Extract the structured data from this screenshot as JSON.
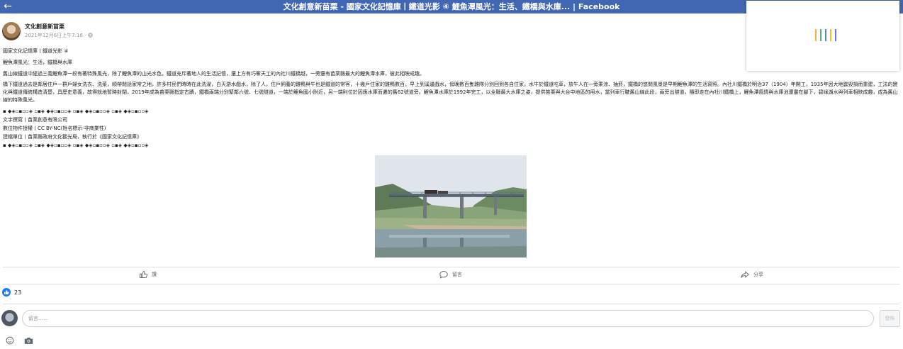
{
  "window": {
    "title": "文化創意新苗栗 - 國家文化記憶庫丨鐵道光影 ④ 鯉魚潭風光：生活、鐵橋與水庫... | Facebook"
  },
  "colors": {
    "header": "#4267b2",
    "like": "#1877f2",
    "loader": [
      "#f5b041",
      "#58b05a",
      "#4a90d9",
      "#f0c419",
      "#6b7ad8"
    ]
  },
  "post": {
    "author": "文化創意新苗栗",
    "timestamp": "2021年12月6日上午7:16 ·",
    "privacy_icon": "globe-icon",
    "lines": [
      "國家文化記憶庫丨鐵道光影 ④",
      "鯉魚潭風光：生活，鐵橋與水庫",
      "舊山線鐵道中經過三義鯉魚潭一段有著特殊風光，除了鯉魚潭的山光水色，鐵道充斥著地人的生活記憶，還上方有巧奪天工的內社川鐵橋越，一旁還有苗栗縣最大的鯉魚潭水庫，彼此相映成趣。",
      "橋下鐵道過去是鄰居住戶一群戶婦女洗衣、洗菜，順帶閒話家常之地，許多村民們時時在此洗濯，白天游水戲水，除了人，住戶飼養的雞鴨與牛也是鐵道的常客，十幾戶住家的雞鴨數百，早上到溪邊戲水，傍晚數百隻雞隊分別回到各自住家。水牛於鐵道吃草，放牛人在一旁乘涼、抽菸，鐵橋的悠閒風景是早期鯉魚潭的生活寫照。內社川鐵橋於明治37（1904）年開工，1935年因大地震毀損而重建，工法的變化與鐵道傳統構造清楚，具歷史意義，故得就地暫時封閉，2019年成為苗栗縣指定古蹟，鐵橋兩端分別緊鄰六號、七號隧道，一端於鯉魚國小附近，另一端則位於因應水庫而遷的舊62號道旁。鯉魚潭水庫於1992年完工，以全縣最大水庫之姿，提供苗栗與大台中地區的用水，當列車行駛舊山線此段，兩旁出隧道，隨即走在內社川鐵橋上，鯉魚潭風情與水庫池還盡在腳下，碧綠湖水與列車相映成趣，成為舊山線的特殊風光。",
      "▪︎ ◆◈▫▪︎▫▫◈ ▫▪︎◈ ◆◈▫▪︎▫▫◈ ▫▪︎◈ ◆◈▫▪︎▫▫◈ ▫▪︎◈ ◆◈▫▪︎▫▫◈",
      "文字撰寫丨苗栗創意有限公司",
      "數位物件授權丨CC BY-NC(姓名標示-非商業性)",
      "建檔單位丨苗栗縣政府文化觀光局，執行於《國家文化記憶庫》",
      "▪︎ ◆◈▫▪︎▫▫◈ ▫▪︎◈ ◆◈▫▪︎▫▫◈ ▫▪︎◈ ◆◈▫▪︎▫▫◈ ▫▪︎◈ ◆◈▫▪︎▫▫◈"
    ],
    "actions": {
      "like": "讚",
      "comment": "留言",
      "share": "分享"
    },
    "like_count": "23"
  },
  "comment": {
    "placeholder": "留言……",
    "send": "發佈"
  }
}
